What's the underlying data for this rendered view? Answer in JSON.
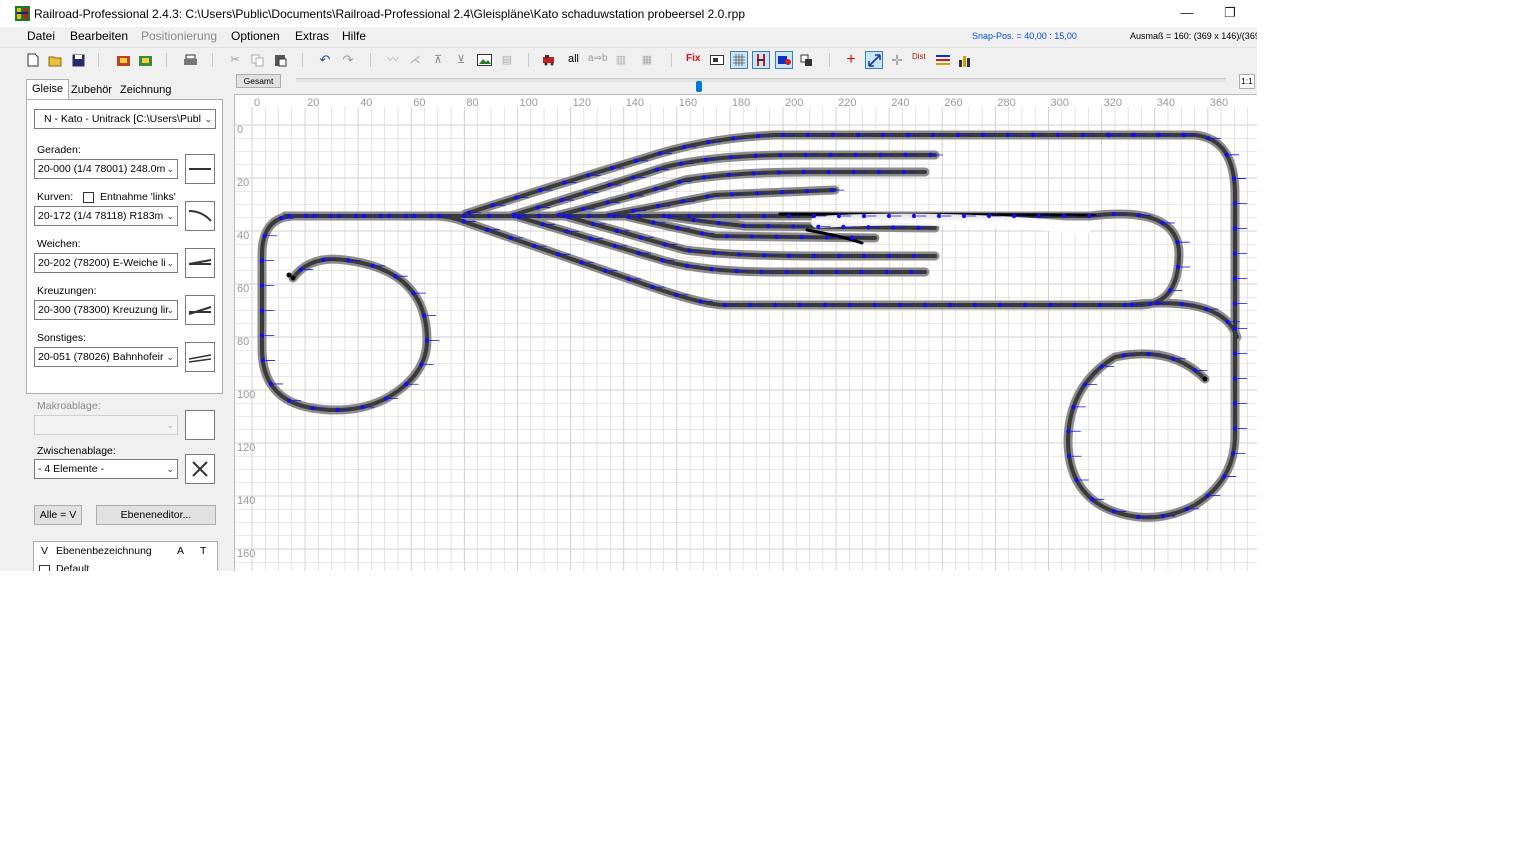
{
  "window": {
    "title": "Railroad-Professional 2.4.3:  C:\\Users\\Public\\Documents\\Railroad-Professional 2.4\\Gleispläne\\Kato schaduwstation probeersel 2.0.rpp",
    "minimize_glyph": "—",
    "restore_glyph": "❐"
  },
  "menu": {
    "items": [
      "Datei",
      "Bearbeiten",
      "Positionierung",
      "Optionen",
      "Extras",
      "Hilfe"
    ],
    "snap_pos": "Snap-Pos. = 40,00 : 15,00",
    "ausmass": "Ausmaß = 160: (369 x 146)/(369"
  },
  "toolbar": {
    "all_label": "all",
    "aeb_label": "a⇒b",
    "fix_label": "Fix",
    "dist_label": "Dist"
  },
  "panel": {
    "tabs": [
      "Gleise",
      "Zubehör",
      "Zeichnung"
    ],
    "library": "N - Kato - Unitrack  [C:\\Users\\Publ",
    "geraden_label": "Geraden:",
    "geraden_value": "20-000 (1/4 78001) 248.0m",
    "kurven_label": "Kurven:",
    "entnahme_label": "Entnahme 'links'",
    "kurven_value": "20-172 (1/4 78118) R183m",
    "weichen_label": "Weichen:",
    "weichen_value": "20-202 (78200) E-Weiche li",
    "kreuzungen_label": "Kreuzungen:",
    "kreuzungen_value": "20-300 (78300) Kreuzung lir",
    "sonstiges_label": "Sonstiges:",
    "sonstiges_value": "20-051 (78026) Bahnhofeir",
    "makro_label": "Makroablage:",
    "zwischen_label": "Zwischenablage:",
    "zwischen_value": "- 4 Elemente -",
    "alle_button": "Alle = V",
    "ebenen_button": "Ebeneneditor...",
    "layer_header": {
      "v": "V",
      "name": "Ebenenbezeichnung",
      "a": "A",
      "t": "T"
    },
    "layer_row": "Default"
  },
  "canvas": {
    "gesamt_label": "Gesamt",
    "zoom_1to1": "1:1",
    "zoom_position": 0.43,
    "ruler_x": [
      "0",
      "20",
      "40",
      "60",
      "80",
      "100",
      "120",
      "140",
      "160",
      "180",
      "200",
      "220",
      "240",
      "260",
      "280",
      "300",
      "320",
      "340",
      "360"
    ],
    "ruler_y": [
      "0",
      "20",
      "40",
      "60",
      "80",
      "100",
      "120",
      "140",
      "160"
    ]
  },
  "colors": {
    "track_rail": "#3a3a3a",
    "track_ballast": "#8c8c8c",
    "connector": "#1010f0",
    "grid": "#d2d2d2",
    "snap_text": "#0050d8"
  }
}
